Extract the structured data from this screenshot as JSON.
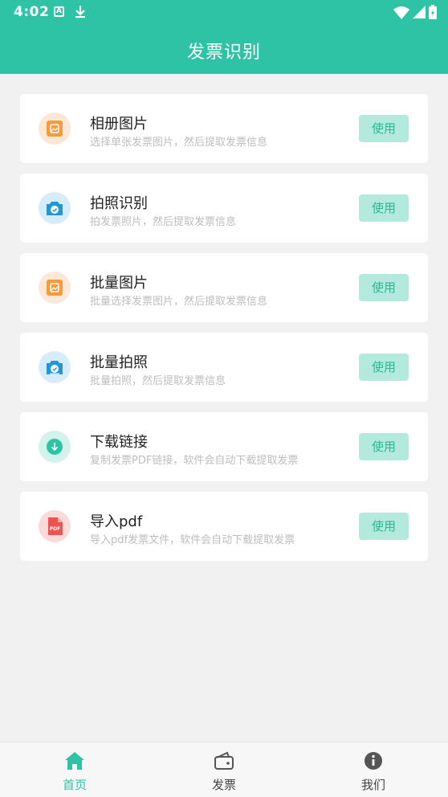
{
  "status": {
    "time": "4:02",
    "a_badge": "A"
  },
  "header": {
    "title": "发票识别"
  },
  "items": [
    {
      "title": "相册图片",
      "subtitle": "选择单张发票图片，然后提取发票信息",
      "button": "使用"
    },
    {
      "title": "拍照识别",
      "subtitle": "拍发票照片，然后提取发票信息",
      "button": "使用"
    },
    {
      "title": "批量图片",
      "subtitle": "批量选择发票图片，然后提取发票信息",
      "button": "使用"
    },
    {
      "title": "批量拍照",
      "subtitle": "批量拍照，然后提取发票信息",
      "button": "使用"
    },
    {
      "title": "下载链接",
      "subtitle": "复制发票PDF链接，软件会自动下载提取发票",
      "button": "使用"
    },
    {
      "title": "导入pdf",
      "subtitle": "导入pdf发票文件，软件会自动下载提取发票",
      "button": "使用"
    }
  ],
  "pdf_badge": "PDF",
  "tabs": [
    {
      "label": "首页",
      "icon": "home-icon"
    },
    {
      "label": "发票",
      "icon": "wallet-icon"
    },
    {
      "label": "我们",
      "icon": "info-icon"
    }
  ],
  "colors": {
    "primary": "#2DC3A4",
    "button_bg": "#B4E9DD",
    "button_text": "#2DB594",
    "page_bg": "#F1F1F2"
  }
}
